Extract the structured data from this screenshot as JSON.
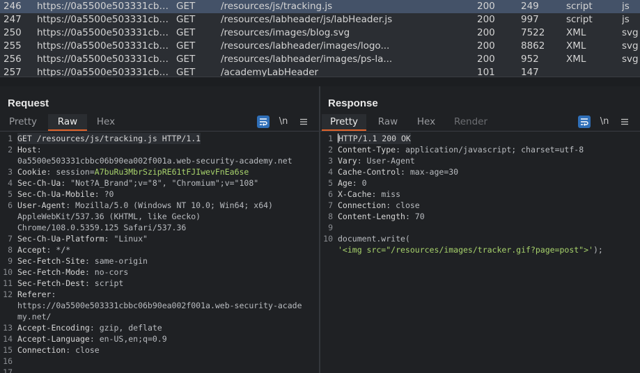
{
  "history": {
    "rows": [
      {
        "id": "246",
        "host": "https://0a5500e503331cbbc...",
        "method": "GET",
        "url": "/resources/js/tracking.js",
        "status": "200",
        "length": "249",
        "mime": "script",
        "ext": "js",
        "selected": true
      },
      {
        "id": "247",
        "host": "https://0a5500e503331cbbc...",
        "method": "GET",
        "url": "/resources/labheader/js/labHeader.js",
        "status": "200",
        "length": "997",
        "mime": "script",
        "ext": "js"
      },
      {
        "id": "250",
        "host": "https://0a5500e503331cbbc...",
        "method": "GET",
        "url": "/resources/images/blog.svg",
        "status": "200",
        "length": "7522",
        "mime": "XML",
        "ext": "svg"
      },
      {
        "id": "255",
        "host": "https://0a5500e503331cbbc...",
        "method": "GET",
        "url": "/resources/labheader/images/logo...",
        "status": "200",
        "length": "8862",
        "mime": "XML",
        "ext": "svg"
      },
      {
        "id": "256",
        "host": "https://0a5500e503331cbbc...",
        "method": "GET",
        "url": "/resources/labheader/images/ps-la...",
        "status": "200",
        "length": "952",
        "mime": "XML",
        "ext": "svg"
      },
      {
        "id": "257",
        "host": "https://0a5500e503331cbbc...",
        "method": "GET",
        "url": "/academyLabHeader",
        "status": "101",
        "length": "147",
        "mime": "",
        "ext": ""
      }
    ]
  },
  "request": {
    "title": "Request",
    "tabs": [
      "Pretty",
      "Raw",
      "Hex"
    ],
    "active_tab": "Raw",
    "newline_label": "\\n",
    "lines": [
      {
        "n": "1",
        "parts": [
          [
            "k",
            "GET /resources/js/tracking.js HTTP/1.1"
          ]
        ]
      },
      {
        "n": "2",
        "parts": [
          [
            "k",
            "Host"
          ],
          [
            "v",
            ":"
          ]
        ]
      },
      {
        "n": "",
        "parts": [
          [
            "v",
            "0a5500e503331cbbc06b90ea002f001a.web-security-academy.net"
          ]
        ]
      },
      {
        "n": "3",
        "parts": [
          [
            "k",
            "Cookie"
          ],
          [
            "v",
            ": session="
          ],
          [
            "g",
            "A7buRu3MbrSzipRE61tFJIwevFnEa6se"
          ]
        ]
      },
      {
        "n": "4",
        "parts": [
          [
            "k",
            "Sec-Ch-Ua"
          ],
          [
            "v",
            ": \"Not?A_Brand\";v=\"8\", \"Chromium\";v=\"108\""
          ]
        ]
      },
      {
        "n": "5",
        "parts": [
          [
            "k",
            "Sec-Ch-Ua-Mobile"
          ],
          [
            "v",
            ": ?0"
          ]
        ]
      },
      {
        "n": "6",
        "parts": [
          [
            "k",
            "User-Agent"
          ],
          [
            "v",
            ": Mozilla/5.0 (Windows NT 10.0; Win64; x64)"
          ]
        ]
      },
      {
        "n": "",
        "parts": [
          [
            "v",
            "AppleWebKit/537.36 (KHTML, like Gecko)"
          ]
        ]
      },
      {
        "n": "",
        "parts": [
          [
            "v",
            "Chrome/108.0.5359.125 Safari/537.36"
          ]
        ]
      },
      {
        "n": "7",
        "parts": [
          [
            "k",
            "Sec-Ch-Ua-Platform"
          ],
          [
            "v",
            ": \"Linux\""
          ]
        ]
      },
      {
        "n": "8",
        "parts": [
          [
            "k",
            "Accept"
          ],
          [
            "v",
            ": */*"
          ]
        ]
      },
      {
        "n": "9",
        "parts": [
          [
            "k",
            "Sec-Fetch-Site"
          ],
          [
            "v",
            ": same-origin"
          ]
        ]
      },
      {
        "n": "10",
        "parts": [
          [
            "k",
            "Sec-Fetch-Mode"
          ],
          [
            "v",
            ": no-cors"
          ]
        ]
      },
      {
        "n": "11",
        "parts": [
          [
            "k",
            "Sec-Fetch-Dest"
          ],
          [
            "v",
            ": script"
          ]
        ]
      },
      {
        "n": "12",
        "parts": [
          [
            "k",
            "Referer"
          ],
          [
            "v",
            ":"
          ]
        ]
      },
      {
        "n": "",
        "parts": [
          [
            "v",
            "https://0a5500e503331cbbc06b90ea002f001a.web-security-acade"
          ]
        ]
      },
      {
        "n": "",
        "parts": [
          [
            "v",
            "my.net/"
          ]
        ]
      },
      {
        "n": "13",
        "parts": [
          [
            "k",
            "Accept-Encoding"
          ],
          [
            "v",
            ": gzip, deflate"
          ]
        ]
      },
      {
        "n": "14",
        "parts": [
          [
            "k",
            "Accept-Language"
          ],
          [
            "v",
            ": en-US,en;q=0.9"
          ]
        ]
      },
      {
        "n": "15",
        "parts": [
          [
            "k",
            "Connection"
          ],
          [
            "v",
            ": close"
          ]
        ]
      },
      {
        "n": "16",
        "parts": [
          [
            "v",
            ""
          ]
        ]
      },
      {
        "n": "17",
        "parts": [
          [
            "v",
            ""
          ]
        ]
      }
    ]
  },
  "response": {
    "title": "Response",
    "tabs": [
      "Pretty",
      "Raw",
      "Hex",
      "Render"
    ],
    "active_tab": "Pretty",
    "newline_label": "\\n",
    "lines": [
      {
        "n": "1",
        "parts": [
          [
            "k",
            "HTTP/1.1 200 OK"
          ]
        ]
      },
      {
        "n": "2",
        "parts": [
          [
            "k",
            "Content-Type"
          ],
          [
            "v",
            ": application/javascript; charset=utf-8"
          ]
        ]
      },
      {
        "n": "3",
        "parts": [
          [
            "k",
            "Vary"
          ],
          [
            "v",
            ": User-Agent"
          ]
        ]
      },
      {
        "n": "4",
        "parts": [
          [
            "k",
            "Cache-Control"
          ],
          [
            "v",
            ": max-age=30"
          ]
        ]
      },
      {
        "n": "5",
        "parts": [
          [
            "k",
            "Age"
          ],
          [
            "v",
            ": 0"
          ]
        ]
      },
      {
        "n": "6",
        "parts": [
          [
            "k",
            "X-Cache"
          ],
          [
            "v",
            ": miss"
          ]
        ]
      },
      {
        "n": "7",
        "parts": [
          [
            "k",
            "Connection"
          ],
          [
            "v",
            ": close"
          ]
        ]
      },
      {
        "n": "8",
        "parts": [
          [
            "k",
            "Content-Length"
          ],
          [
            "v",
            ": 70"
          ]
        ]
      },
      {
        "n": "9",
        "parts": [
          [
            "v",
            ""
          ]
        ]
      },
      {
        "n": "10",
        "parts": [
          [
            "v",
            "document.write("
          ]
        ]
      },
      {
        "n": "",
        "parts": [
          [
            "s",
            "'<img src=\"/resources/images/tracker.gif?page=post\">'"
          ],
          [
            "v",
            ");"
          ]
        ]
      }
    ]
  },
  "colors": {
    "accent": "#e0622a",
    "selection": "#445268",
    "button_blue": "#2f6fb8",
    "string_green": "#a8d36c"
  },
  "icons": [
    "word-wrap-icon",
    "newline-icon",
    "menu-icon",
    "layout-side-by-side-icon",
    "layout-stacked-icon",
    "layout-single-icon"
  ]
}
